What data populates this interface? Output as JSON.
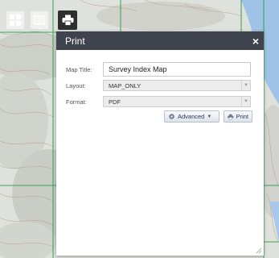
{
  "toolbar": {
    "basemap_icon": "grid-icon",
    "layers_icon": "layers-icon",
    "print_icon": "printer-icon"
  },
  "print_panel": {
    "title": "Print",
    "close_label": "×",
    "fields": {
      "map_title_label": "Map Title:",
      "map_title_value": "Survey Index Map",
      "layout_label": "Layout:",
      "layout_value": "MAP_ONLY",
      "format_label": "Format:",
      "format_value": "PDF"
    },
    "buttons": {
      "advanced_label": "Advanced",
      "print_label": "Print"
    }
  },
  "colors": {
    "panel_header": "#3e434e",
    "survey_grid_line": "#2ca24a",
    "water": "#9fc3e6"
  }
}
